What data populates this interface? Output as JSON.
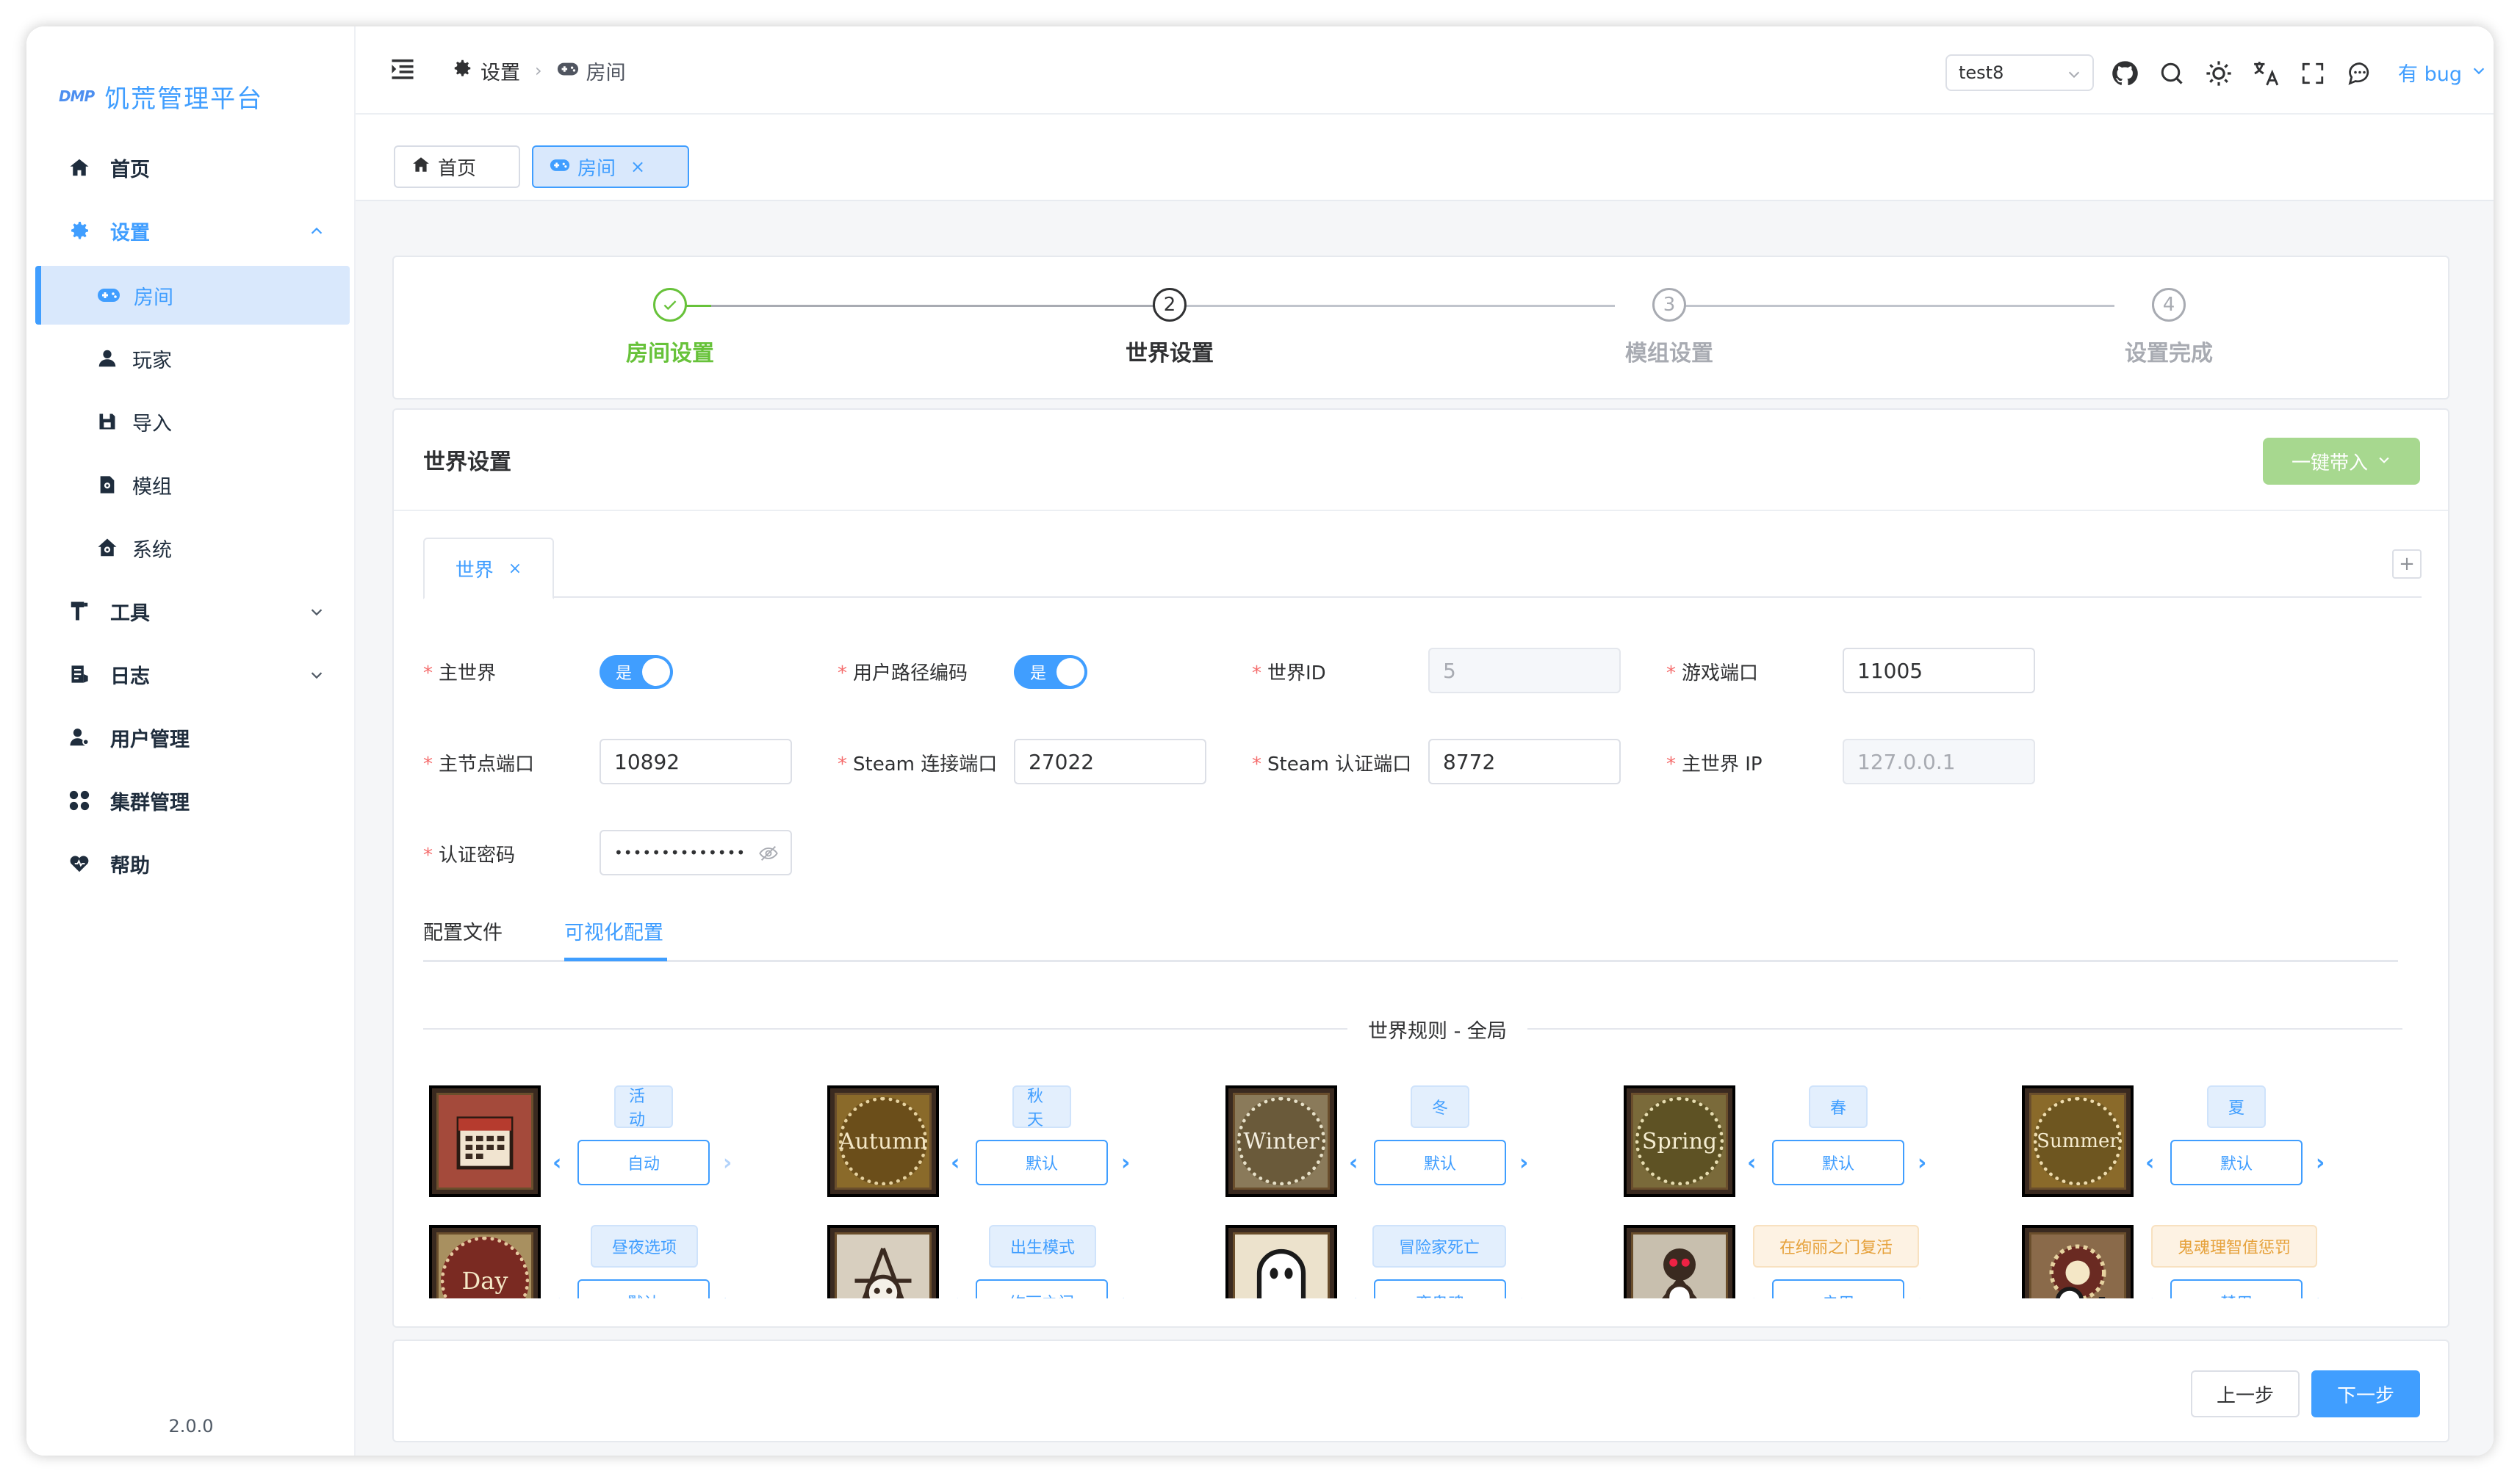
{
  "app": {
    "logo_mark": "DMP",
    "title": "饥荒管理平台",
    "version": "2.0.0"
  },
  "sidebar": {
    "items": [
      {
        "label": "首页",
        "icon": "home-icon"
      },
      {
        "label": "设置",
        "icon": "gear-icon"
      },
      {
        "label": "房间",
        "icon": "gamepad-icon"
      },
      {
        "label": "玩家",
        "icon": "user-icon"
      },
      {
        "label": "导入",
        "icon": "save-icon"
      },
      {
        "label": "模组",
        "icon": "mod-icon"
      },
      {
        "label": "系统",
        "icon": "house-gear-icon"
      },
      {
        "label": "工具",
        "icon": "tool-icon"
      },
      {
        "label": "日志",
        "icon": "log-icon"
      },
      {
        "label": "用户管理",
        "icon": "user-manage-icon"
      },
      {
        "label": "集群管理",
        "icon": "cluster-icon"
      },
      {
        "label": "帮助",
        "icon": "heart-icon"
      }
    ]
  },
  "header": {
    "breadcrumb": [
      "设置",
      "房间"
    ],
    "cluster_select": "test8",
    "user": "有 bug"
  },
  "tags": [
    {
      "label": "首页"
    },
    {
      "label": "房间"
    }
  ],
  "steps": [
    {
      "label": "房间设置",
      "number": "1",
      "status": "done"
    },
    {
      "label": "世界设置",
      "number": "2",
      "status": "current"
    },
    {
      "label": "模组设置",
      "number": "3",
      "status": "wait"
    },
    {
      "label": "设置完成",
      "number": "4",
      "status": "wait"
    }
  ],
  "world": {
    "title": "世界设置",
    "import_button": "一键带入",
    "tab": "世界",
    "add_tab": "+",
    "fields": {
      "main_world": {
        "label": "主世界",
        "value": "是"
      },
      "path_encode": {
        "label": "用户路径编码",
        "value": "是"
      },
      "world_id": {
        "label": "世界ID",
        "value": "5"
      },
      "game_port": {
        "label": "游戏端口",
        "value": "11005"
      },
      "master_port": {
        "label": "主节点端口",
        "value": "10892"
      },
      "steam_port": {
        "label": "Steam 连接端口",
        "value": "27022"
      },
      "steam_auth_port": {
        "label": "Steam 认证端口",
        "value": "8772"
      },
      "master_ip": {
        "label": "主世界 IP",
        "value": "127.0.0.1"
      },
      "auth_password": {
        "label": "认证密码",
        "value": "••••••••••••••"
      }
    },
    "config_tabs": [
      "配置文件",
      "可视化配置"
    ],
    "rules_title": "世界规则 - 全局",
    "rules": [
      {
        "title": "活动",
        "value": "自动",
        "icon": "calendar-icon",
        "warn": false
      },
      {
        "title": "秋天",
        "value": "默认",
        "icon": "autumn-icon",
        "art": "Autumn",
        "warn": false
      },
      {
        "title": "冬",
        "value": "默认",
        "icon": "winter-icon",
        "art": "Winter",
        "warn": false
      },
      {
        "title": "春",
        "value": "默认",
        "icon": "spring-icon",
        "art": "Spring",
        "warn": false
      },
      {
        "title": "夏",
        "value": "默认",
        "icon": "summer-icon",
        "art": "Summer",
        "warn": false
      },
      {
        "title": "昼夜选项",
        "value": "默认",
        "icon": "day-icon",
        "art": "Day",
        "warn": false
      },
      {
        "title": "出生模式",
        "value": "绚丽之门",
        "icon": "spawn-icon",
        "warn": false
      },
      {
        "title": "冒险家死亡",
        "value": "变鬼魂",
        "icon": "ghost-icon",
        "warn": false
      },
      {
        "title": "在绚丽之门复活",
        "value": "启用",
        "icon": "portal-revive-icon",
        "warn": true
      },
      {
        "title": "鬼魂理智值惩罚",
        "value": "禁用",
        "icon": "ghost-sanity-icon",
        "warn": true
      }
    ]
  },
  "footer": {
    "prev": "上一步",
    "next": "下一步"
  },
  "colors": {
    "primary": "#409eff",
    "success": "#67c23a",
    "import_btn": "#a7d88f",
    "warn": "#e6a23c"
  }
}
